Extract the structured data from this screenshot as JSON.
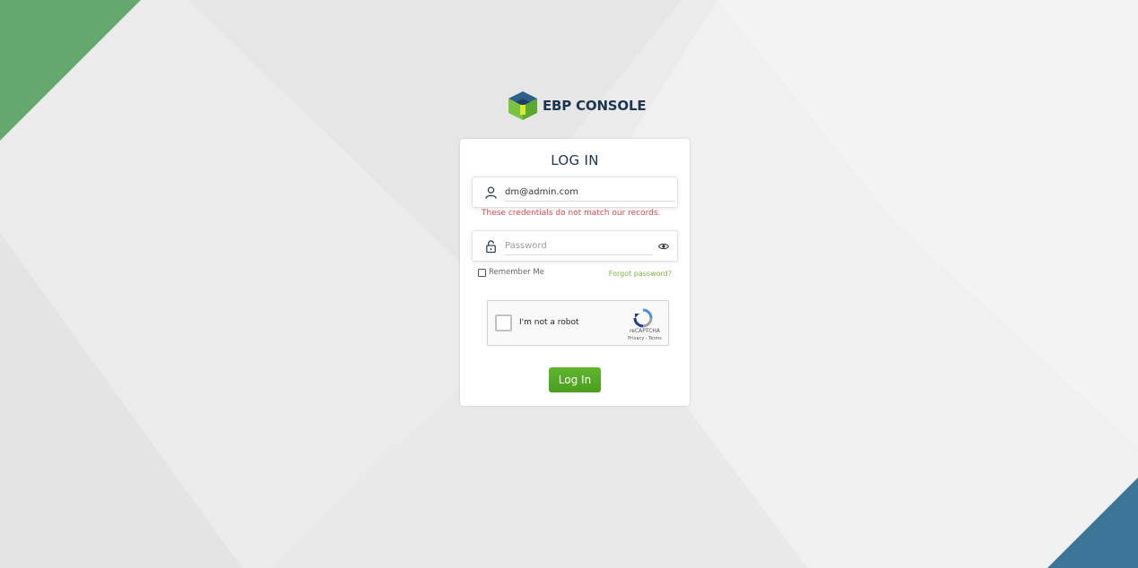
{
  "app": {
    "brand_name": "EBP CONSOLE",
    "logo_icon": "cube-logo-icon"
  },
  "colors": {
    "accent_green": "#5aa830",
    "brand_navy": "#1e3550",
    "error_red": "#e0474c",
    "link_green": "#7fb24a",
    "corner_green": "#65a86e",
    "corner_blue": "#3d7599"
  },
  "login": {
    "title": "LOG IN",
    "email": {
      "value": "dm@admin.com",
      "icon": "user-icon"
    },
    "error_message": "These credentials do not match our records.",
    "password": {
      "placeholder": "Password",
      "icon": "lock-icon",
      "toggle_icon": "eye-icon"
    },
    "remember_label": "Remember Me",
    "forgot_label": "Forgot password?",
    "submit_label": "Log In"
  },
  "recaptcha": {
    "label": "I'm not a robot",
    "brand": "reCAPTCHA",
    "links": "Privacy - Terms"
  }
}
